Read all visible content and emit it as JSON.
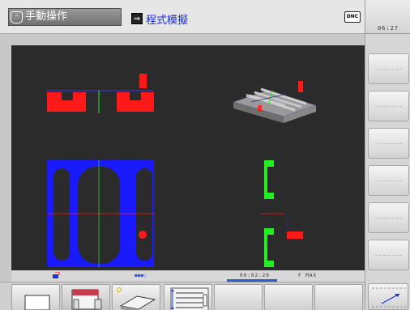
{
  "header": {
    "mode_tab_label": "手動操作",
    "program_tab_label": "程式模擬",
    "dnc_label": "DNC"
  },
  "clock": "06:27",
  "status": {
    "time": "00:02:20",
    "feed": "F MAX",
    "page_dots": "●●●○"
  },
  "colors": {
    "background": "#2b2b2b",
    "workpiece_blue": "#1a1aff",
    "cut_red": "#ff1a1a",
    "tool_green": "#22ee22",
    "accent_blue": "#1a2fd8"
  },
  "softkeys": [
    {
      "name": "blank-workpiece",
      "active": false
    },
    {
      "name": "three-plane-view",
      "active": true
    },
    {
      "name": "3d-view",
      "active": false
    },
    {
      "name": "program-view",
      "active": false
    },
    {
      "name": "empty",
      "active": false
    },
    {
      "name": "empty",
      "active": false
    },
    {
      "name": "empty",
      "active": false
    }
  ]
}
